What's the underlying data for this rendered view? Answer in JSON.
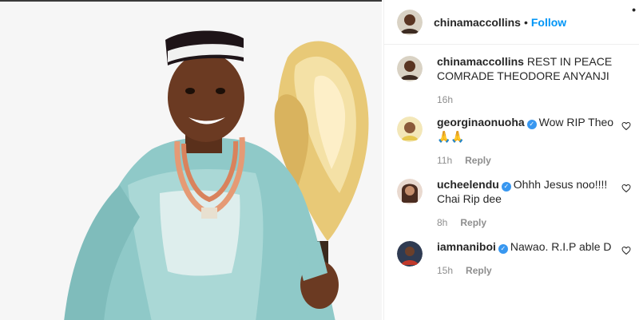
{
  "post": {
    "author": "chinamaccollins",
    "follow_label": "Follow",
    "separator": "•",
    "more_label": "•"
  },
  "comments": [
    {
      "user": "chinamaccollins",
      "text": "REST IN PEACE COMRADE THEODORE ANYANJI",
      "time": "16h",
      "verified": false,
      "has_reply": false
    },
    {
      "user": "georginaonuoha",
      "text": "Wow RIP Theo 🙏🙏",
      "time": "11h",
      "reply_label": "Reply",
      "verified": true
    },
    {
      "user": "ucheelendu",
      "text": "Ohhh Jesus noo!!!! Chai Rip dee",
      "time": "8h",
      "reply_label": "Reply",
      "verified": true
    },
    {
      "user": "iamnaniboi",
      "text": "Nawao. R.I.P able D",
      "time": "15h",
      "reply_label": "Reply",
      "verified": true
    }
  ],
  "icons": {
    "verified": "verified-badge-icon",
    "like": "heart-icon"
  },
  "colors": {
    "link": "#0095f6",
    "muted": "#8e8e8e",
    "verified": "#3897f0"
  }
}
